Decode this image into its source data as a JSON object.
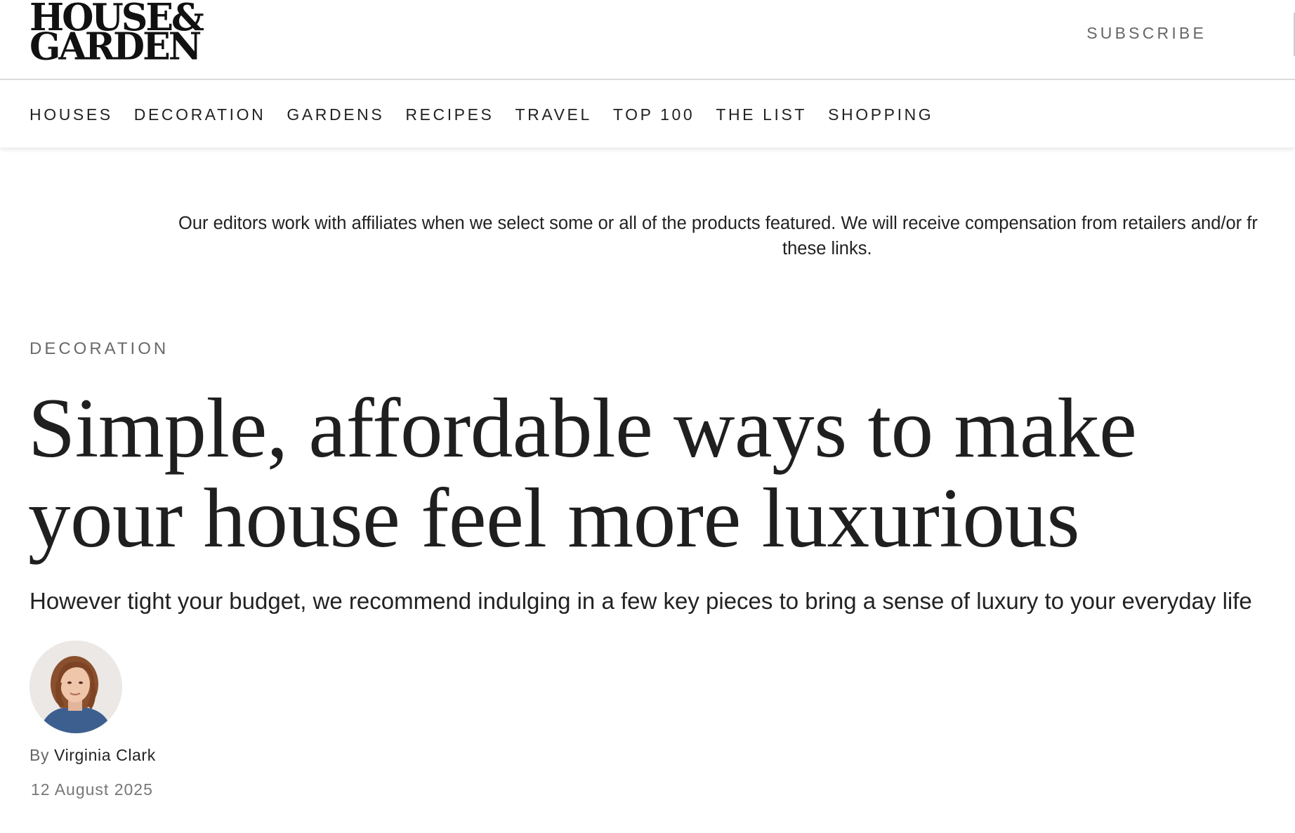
{
  "header": {
    "logo_line1": "HOUSE&",
    "logo_line2": "GARDEN",
    "subscribe_label": "SUBSCRIBE"
  },
  "nav": {
    "items": [
      {
        "label": "HOUSES"
      },
      {
        "label": "DECORATION"
      },
      {
        "label": "GARDENS"
      },
      {
        "label": "RECIPES"
      },
      {
        "label": "TRAVEL"
      },
      {
        "label": "TOP 100"
      },
      {
        "label": "THE LIST"
      },
      {
        "label": "SHOPPING"
      }
    ]
  },
  "disclaimer": {
    "line1": "Our editors work with affiliates when we select some or all of the products featured. We will receive compensation from retailers and/or fr",
    "line2": "these links."
  },
  "article": {
    "category": "DECORATION",
    "headline": "Simple, affordable ways to make your house feel more luxurious",
    "dek": "However tight your budget, we recommend indulging in a few key pieces to bring a sense of luxury to your everyday life",
    "byline_prefix": "By",
    "author": "Virginia Clark",
    "date": "12 August 2025"
  },
  "colors": {
    "text": "#222222",
    "muted": "#666666",
    "divider": "#dcdcdc",
    "background": "#ffffff"
  }
}
